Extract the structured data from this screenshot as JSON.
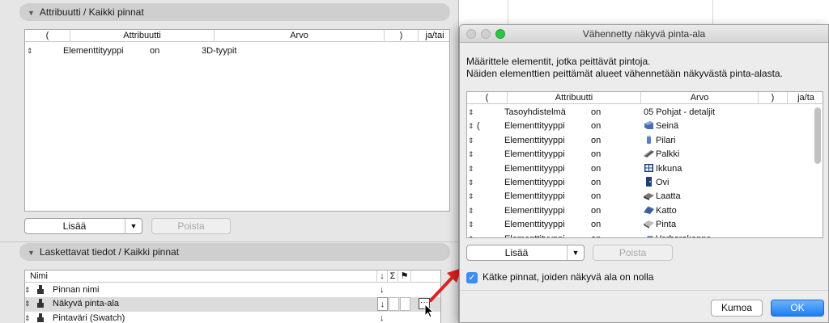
{
  "attributes_section": {
    "header": "Attribuutti /  Kaikki pinnat",
    "columns": [
      "(",
      "Attribuutti",
      "Arvo",
      ")",
      "ja/tai"
    ],
    "rows": [
      {
        "paren_open": "",
        "attribute": "Elementtityyppi",
        "op": "on",
        "value": "3D-tyypit"
      }
    ],
    "add_button": "Lisää",
    "remove_button": "Poista"
  },
  "calculated_section": {
    "header": "Laskettavat tiedot /  Kaikki pinnat",
    "columns": [
      "Nimi",
      "↓",
      "Σ",
      "⚑"
    ],
    "rows": [
      {
        "name": "Pinnan nimi",
        "arrow": "↓",
        "selected": false
      },
      {
        "name": "Näkyvä pinta-ala",
        "arrow": "↓",
        "selected": true
      },
      {
        "name": "Pintaväri (Swatch)",
        "arrow": "↓",
        "selected": false
      }
    ]
  },
  "dialog": {
    "title": "Vähennetty näkyvä pinta-ala",
    "description_line1": "Määrittele elementit, jotka peittävät pintoja.",
    "description_line2": "Näiden elementtien peittämät alueet vähennetään näkyvästä pinta-alasta.",
    "columns": [
      "(",
      "Attribuutti",
      "Arvo",
      ")",
      "ja/ta"
    ],
    "rows": [
      {
        "paren": "",
        "attribute": "Tasoyhdistelmä",
        "op": "on",
        "value": "05 Pohjat - detaljit",
        "icon": ""
      },
      {
        "paren": "(",
        "attribute": "Elementtityyppi",
        "op": "on",
        "value": "Seinä",
        "icon": "wall-icon"
      },
      {
        "paren": "",
        "attribute": "Elementtityyppi",
        "op": "on",
        "value": "Pilari",
        "icon": "column-icon"
      },
      {
        "paren": "",
        "attribute": "Elementtityyppi",
        "op": "on",
        "value": "Palkki",
        "icon": "beam-icon"
      },
      {
        "paren": "",
        "attribute": "Elementtityyppi",
        "op": "on",
        "value": "Ikkuna",
        "icon": "window-icon"
      },
      {
        "paren": "",
        "attribute": "Elementtityyppi",
        "op": "on",
        "value": "Ovi",
        "icon": "door-icon"
      },
      {
        "paren": "",
        "attribute": "Elementtityyppi",
        "op": "on",
        "value": "Laatta",
        "icon": "slab-icon"
      },
      {
        "paren": "",
        "attribute": "Elementtityyppi",
        "op": "on",
        "value": "Katto",
        "icon": "roof-icon"
      },
      {
        "paren": "",
        "attribute": "Elementtityyppi",
        "op": "on",
        "value": "Pinta",
        "icon": "surface-icon"
      },
      {
        "paren": "",
        "attribute": "Elementtityyppi",
        "op": "on",
        "value": "Verhorakenne",
        "icon": "curtainwall-icon"
      }
    ],
    "add_button": "Lisää",
    "remove_button": "Poista",
    "checkbox_label": "Kätke pinnat, joiden näkyvä ala on nolla",
    "checkbox_checked": true,
    "cancel_button": "Kumoa",
    "ok_button": "OK"
  },
  "colors": {
    "accent": "#1b7ef5",
    "arrow": "#e02020",
    "selected_row": "#dcdcdc"
  }
}
